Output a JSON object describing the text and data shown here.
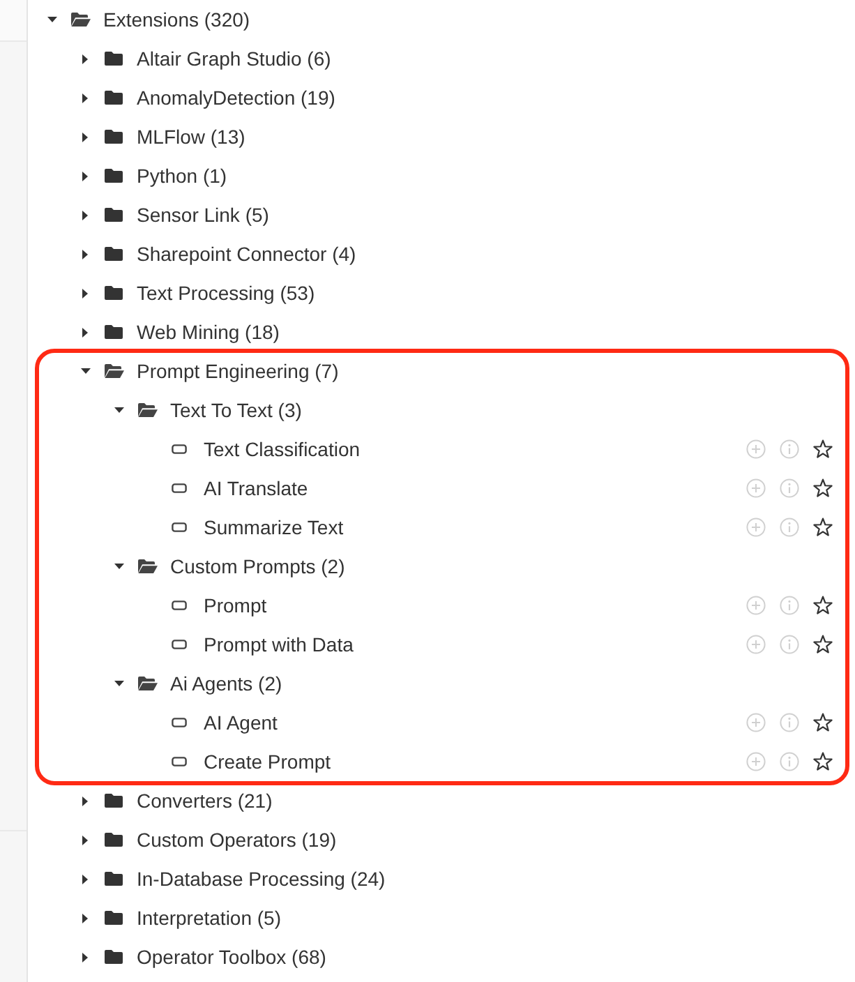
{
  "tree": [
    {
      "kind": "folder",
      "label": "Extensions (320)",
      "expanded": true,
      "children": [
        {
          "kind": "folder",
          "label": "Altair Graph Studio (6)",
          "expanded": false,
          "highlighted": false
        },
        {
          "kind": "folder",
          "label": "AnomalyDetection (19)",
          "expanded": false,
          "highlighted": false
        },
        {
          "kind": "folder",
          "label": "MLFlow (13)",
          "expanded": false,
          "highlighted": false
        },
        {
          "kind": "folder",
          "label": "Python (1)",
          "expanded": false,
          "highlighted": false
        },
        {
          "kind": "folder",
          "label": "Sensor Link (5)",
          "expanded": false,
          "highlighted": false
        },
        {
          "kind": "folder",
          "label": "Sharepoint Connector (4)",
          "expanded": false,
          "highlighted": false
        },
        {
          "kind": "folder",
          "label": "Text Processing (53)",
          "expanded": false,
          "highlighted": false
        },
        {
          "kind": "folder",
          "label": "Web Mining (18)",
          "expanded": false,
          "highlighted": false
        },
        {
          "kind": "folder",
          "label": "Prompt Engineering (7)",
          "expanded": true,
          "highlighted": true,
          "children": [
            {
              "kind": "folder",
              "label": "Text To Text (3)",
              "expanded": true,
              "children": [
                {
                  "kind": "operator",
                  "label": "Text Classification",
                  "favorite": false
                },
                {
                  "kind": "operator",
                  "label": "AI Translate",
                  "favorite": false
                },
                {
                  "kind": "operator",
                  "label": "Summarize Text",
                  "favorite": false
                }
              ]
            },
            {
              "kind": "folder",
              "label": "Custom Prompts (2)",
              "expanded": true,
              "children": [
                {
                  "kind": "operator",
                  "label": "Prompt",
                  "favorite": false
                },
                {
                  "kind": "operator",
                  "label": "Prompt with Data",
                  "favorite": false
                }
              ]
            },
            {
              "kind": "folder",
              "label": "Ai Agents (2)",
              "expanded": true,
              "children": [
                {
                  "kind": "operator",
                  "label": "AI Agent",
                  "favorite": false
                },
                {
                  "kind": "operator",
                  "label": "Create Prompt",
                  "favorite": false
                }
              ]
            }
          ]
        },
        {
          "kind": "folder",
          "label": "Converters (21)",
          "expanded": false,
          "highlighted": false
        },
        {
          "kind": "folder",
          "label": "Custom Operators (19)",
          "expanded": false,
          "highlighted": false
        },
        {
          "kind": "folder",
          "label": "In-Database Processing (24)",
          "expanded": false,
          "highlighted": false
        },
        {
          "kind": "folder",
          "label": "Interpretation (5)",
          "expanded": false,
          "highlighted": false
        },
        {
          "kind": "folder",
          "label": "Operator Toolbox (68)",
          "expanded": false,
          "highlighted": false
        }
      ]
    }
  ]
}
